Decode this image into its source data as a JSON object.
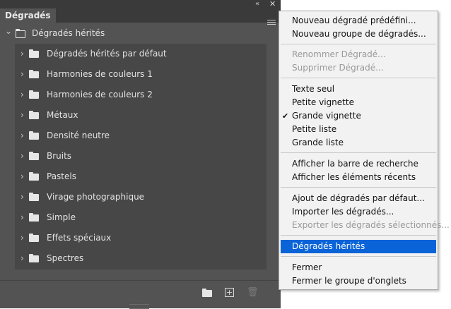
{
  "panel": {
    "tab_label": "Dégradés",
    "root_label": "Dégradés hérités",
    "groups": [
      {
        "label": "Dégradés hérités par défaut"
      },
      {
        "label": "Harmonies de couleurs 1"
      },
      {
        "label": "Harmonies de couleurs 2"
      },
      {
        "label": "Métaux"
      },
      {
        "label": "Densité neutre"
      },
      {
        "label": "Bruits"
      },
      {
        "label": "Pastels"
      },
      {
        "label": "Virage photographique"
      },
      {
        "label": "Simple"
      },
      {
        "label": "Effets spéciaux"
      },
      {
        "label": "Spectres"
      }
    ],
    "glyphs": {
      "collapse": "«",
      "close": "✕",
      "chevron_right": "›",
      "chevron_down": "⌄",
      "new": "+",
      "trash": "🗑"
    }
  },
  "menu": {
    "items": [
      {
        "label": "Nouveau dégradé prédéfini...",
        "disabled": false
      },
      {
        "label": "Nouveau groupe de dégradés...",
        "disabled": false
      },
      {
        "label": "Renommer Dégradé...",
        "disabled": true
      },
      {
        "label": "Supprimer Dégradé...",
        "disabled": true
      },
      {
        "label": "Texte seul",
        "disabled": false
      },
      {
        "label": "Petite vignette",
        "disabled": false
      },
      {
        "label": "Grande vignette",
        "disabled": false,
        "checked": true
      },
      {
        "label": "Petite liste",
        "disabled": false
      },
      {
        "label": "Grande liste",
        "disabled": false
      },
      {
        "label": "Afficher la barre de recherche",
        "disabled": false
      },
      {
        "label": "Afficher les éléments récents",
        "disabled": false
      },
      {
        "label": "Ajout de dégradés par défaut...",
        "disabled": false
      },
      {
        "label": "Importer les dégradés...",
        "disabled": false
      },
      {
        "label": "Exporter les dégradés sélectionnés...",
        "disabled": true
      },
      {
        "label": "Dégradés hérités",
        "disabled": false,
        "highlighted": true
      },
      {
        "label": "Fermer",
        "disabled": false
      },
      {
        "label": "Fermer le groupe d'onglets",
        "disabled": false
      }
    ],
    "check_glyph": "✔"
  },
  "colors": {
    "panel_bg": "#535353",
    "list_bg": "#474747",
    "menu_bg": "#f2f2f2",
    "highlight": "#0a64d8"
  }
}
